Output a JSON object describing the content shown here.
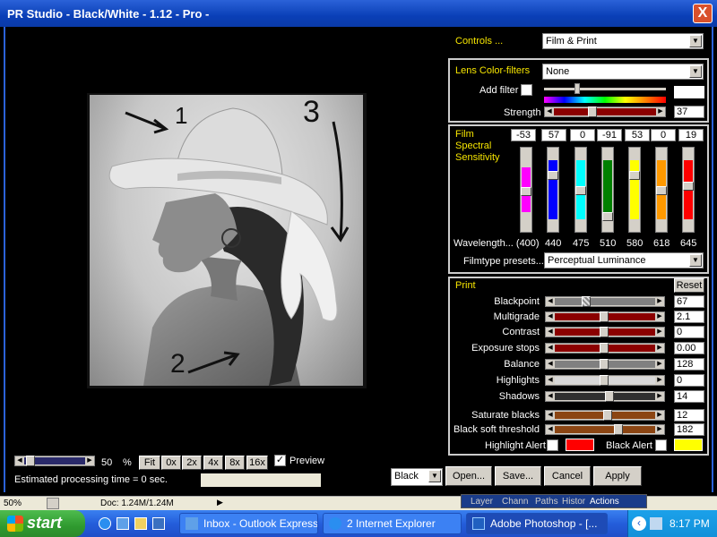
{
  "window": {
    "title": "PR Studio - Black/White - 1.12 - Pro -",
    "close": "X"
  },
  "controls": {
    "label": "Controls ...",
    "value": "Film & Print"
  },
  "lens": {
    "label": "Lens Color-filters",
    "value": "None",
    "add_filter_label": "Add filter",
    "strength_label": "Strength",
    "strength_value": "37"
  },
  "film": {
    "label_lines": [
      "Film",
      "Spectral",
      "Sensitivity"
    ],
    "values": [
      "-53",
      "57",
      "0",
      "-91",
      "53",
      "0",
      "19"
    ],
    "wavelength_label": "Wavelength... (400)",
    "wavelengths": [
      "440",
      "475",
      "510",
      "580",
      "618",
      "645"
    ],
    "preset_label": "Filmtype presets...",
    "preset_value": "Perceptual Luminance"
  },
  "print": {
    "label": "Print",
    "reset": "Reset",
    "rows": [
      {
        "label": "Blackpoint",
        "value": "67"
      },
      {
        "label": "Multigrade",
        "value": "2.1"
      },
      {
        "label": "Contrast",
        "value": "0"
      },
      {
        "label": "Exposure stops",
        "value": "0.00"
      },
      {
        "label": "Balance",
        "value": "128"
      },
      {
        "label": "Highlights",
        "value": "0"
      },
      {
        "label": "Shadows",
        "value": "14"
      },
      {
        "label": "Saturate blacks",
        "value": "12"
      },
      {
        "label": "Black soft threshold",
        "value": "182"
      }
    ],
    "highlight_alert": "Highlight Alert",
    "black_alert": "Black Alert"
  },
  "zoom": {
    "value": "50",
    "unit": "%",
    "buttons": [
      "Fit",
      "0x",
      "2x",
      "4x",
      "8x",
      "16x"
    ],
    "preview": "Preview",
    "estimate": "Estimated processing time =  0 sec."
  },
  "bottom": {
    "mode": "Black",
    "open": "Open...",
    "save": "Save...",
    "cancel": "Cancel",
    "apply": "Apply"
  },
  "annotations": [
    "1",
    "2",
    "3"
  ],
  "photoshop": {
    "zoom": "50%",
    "doc": "Doc: 1.24M/1.24M",
    "tabs": [
      "Layer",
      "Chann",
      "Paths",
      "Histor",
      "Actions"
    ]
  },
  "taskbar": {
    "start": "start",
    "tasks": [
      "Inbox - Outlook Express",
      "2 Internet Explorer",
      "Adobe Photoshop - [..."
    ],
    "time": "8:17 PM"
  }
}
